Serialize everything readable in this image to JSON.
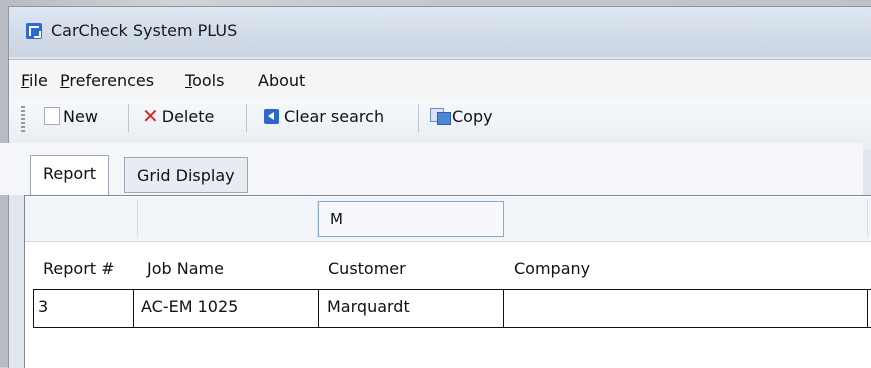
{
  "window": {
    "title": "CarCheck System PLUS"
  },
  "menu": {
    "items": [
      {
        "label": "File",
        "underline": "F"
      },
      {
        "label": "Preferences",
        "underline": "P"
      },
      {
        "label": "Tools",
        "underline": "T"
      },
      {
        "label": "About",
        "underline": ""
      }
    ]
  },
  "toolbar": {
    "new_label": "New",
    "delete_label": "Delete",
    "clear_label": "Clear search",
    "copy_label": "Copy"
  },
  "tabs": {
    "report": "Report",
    "grid_display": "Grid Display"
  },
  "grid": {
    "filters": {
      "customer_value": "M"
    },
    "columns": [
      "Report #",
      "Job Name",
      "Customer",
      "Company"
    ],
    "rows": [
      {
        "report": "3",
        "job_name": "AC-EM 1025",
        "customer": "Marquardt",
        "company": ""
      }
    ]
  }
}
